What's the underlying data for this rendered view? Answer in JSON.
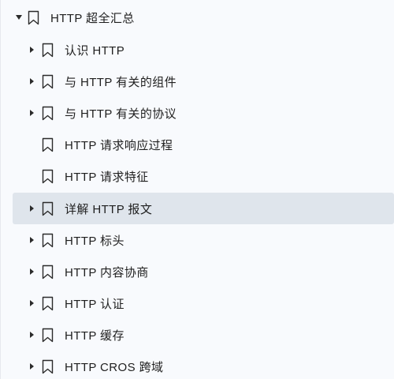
{
  "outline": {
    "root": {
      "label": "HTTP 超全汇总",
      "expanded": true,
      "icon": "bookmark-icon"
    },
    "items": [
      {
        "label": "认识 HTTP",
        "has_children": true,
        "expanded": false,
        "selected": false
      },
      {
        "label": "与 HTTP 有关的组件",
        "has_children": true,
        "expanded": false,
        "selected": false
      },
      {
        "label": "与 HTTP 有关的协议",
        "has_children": true,
        "expanded": false,
        "selected": false
      },
      {
        "label": "HTTP 请求响应过程",
        "has_children": false,
        "expanded": false,
        "selected": false
      },
      {
        "label": "HTTP 请求特征",
        "has_children": false,
        "expanded": false,
        "selected": false
      },
      {
        "label": "详解 HTTP 报文",
        "has_children": true,
        "expanded": false,
        "selected": true
      },
      {
        "label": "HTTP 标头",
        "has_children": true,
        "expanded": false,
        "selected": false
      },
      {
        "label": "HTTP 内容协商",
        "has_children": true,
        "expanded": false,
        "selected": false
      },
      {
        "label": "HTTP 认证",
        "has_children": true,
        "expanded": false,
        "selected": false
      },
      {
        "label": "HTTP 缓存",
        "has_children": true,
        "expanded": false,
        "selected": false
      },
      {
        "label": "HTTP CROS 跨域",
        "has_children": true,
        "expanded": false,
        "selected": false
      }
    ]
  },
  "colors": {
    "background": "#f8fafd",
    "selected_row": "#dfe5ec",
    "text": "#1f1f1f",
    "icon_stroke": "#2b2b2b"
  }
}
